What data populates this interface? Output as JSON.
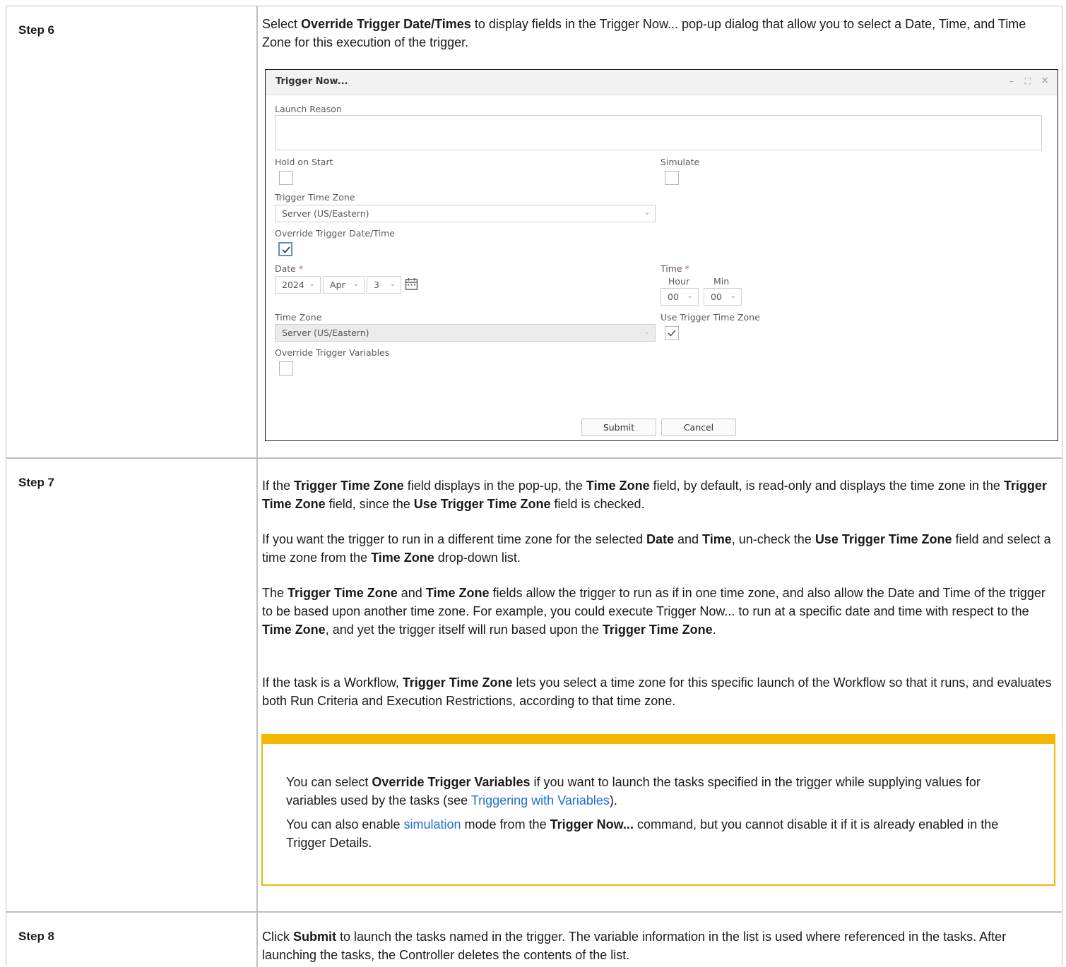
{
  "steps": [
    {
      "label": "Step 6",
      "intro": {
        "t1": "Select ",
        "b1": "Override Trigger Date/Times",
        "t2": " to display fields in the Trigger Now... pop-up dialog that allow you to select a Date, Time, and Time Zone for this execution of the trigger."
      }
    },
    {
      "label": "Step 7",
      "p1": {
        "t1": "If the ",
        "b1": "Trigger Time Zone",
        "t2": " field displays in the pop-up, the ",
        "b2": "Time Zone",
        "t3": " field, by default, is read-only and displays the time zone in the ",
        "b3": "Trigger Time Zone",
        "t4": " field, since the ",
        "b4": "Use Trigger Time Zone",
        "t5": " field is checked."
      },
      "p2": {
        "t1": "If you want the trigger to run in a different time zone for the selected ",
        "b1": "Date",
        "t2": " and ",
        "b2": "Time",
        "t3": ", un-check the ",
        "b3": "Use Trigger Time Zone",
        "t4": " field and select a time zone from the ",
        "b4": "Time Zone",
        "t5": " drop-down list."
      },
      "p3": {
        "t0": "The ",
        "b1": "Trigger Time Zone",
        "t1": " and ",
        "b2": "Time Zone",
        "t2": " fields allow the trigger to run as if in one time zone, and also allow the Date and Time of the trigger to be based upon another time zone. For example, you could execute Trigger Now... to run at a specific date and time with respect to the ",
        "b3": "Time Zone",
        "t3": ", and yet the trigger itself will run based upon the ",
        "b4": "Trigger Time Zone",
        "t4": "."
      },
      "p4": {
        "t1": "If the task is a Workflow, ",
        "b1": "Trigger Time Zone",
        "t2": " lets you select a time zone for this specific launch of the Workflow so that it runs, and evaluates both Run Criteria and Execution Restrictions, according to that time zone."
      },
      "note": {
        "n1": {
          "t1": "You can select ",
          "b1": "Override Trigger Variables",
          "t2": " if you want to launch the tasks specified in the trigger while supplying values for variables used by the tasks (see ",
          "link": "Triggering with Variables",
          "t3": ")."
        },
        "n2": {
          "t1": "You can also enable ",
          "link": "simulation",
          "t2": " mode from the ",
          "b1": "Trigger Now...",
          "t3": " command, but you cannot disable it if it is already enabled in the Trigger Details."
        }
      }
    },
    {
      "label": "Step 8",
      "p": {
        "t1": "Click ",
        "b1": "Submit",
        "t2": " to launch the tasks named in the trigger. The variable information in the list is used where referenced in the tasks. After launching the tasks, the Controller deletes the contents of the list."
      }
    }
  ],
  "dialog": {
    "title": "Trigger Now...",
    "controls": {
      "minimize": "–",
      "maximize": "⛶",
      "close": "×"
    },
    "launch_reason_label": "Launch Reason",
    "hold_on_start_label": "Hold on Start",
    "simulate_label": "Simulate",
    "trigger_time_zone_label": "Trigger Time Zone",
    "trigger_time_zone_value": "Server (US/Eastern)",
    "override_date_label": "Override Trigger Date/Time",
    "override_date_checked": true,
    "date_label": "Date",
    "required_mark": "*",
    "year": "2024",
    "month": "Apr",
    "day": "3",
    "time_label": "Time",
    "hour_label": "Hour",
    "min_label": "Min",
    "hour": "00",
    "minute": "00",
    "time_zone_label": "Time Zone",
    "time_zone_value": "Server (US/Eastern)",
    "use_trigger_tz_label": "Use Trigger Time Zone",
    "use_trigger_tz_checked": true,
    "override_vars_label": "Override Trigger Variables",
    "override_vars_checked": false,
    "submit_label": "Submit",
    "cancel_label": "Cancel",
    "chevron": "⌄"
  },
  "colors": {
    "note_border": "#f5b800",
    "link": "#1f6fc5",
    "required": "#d9534f",
    "checkbox_focus": "#5b8fc9"
  }
}
